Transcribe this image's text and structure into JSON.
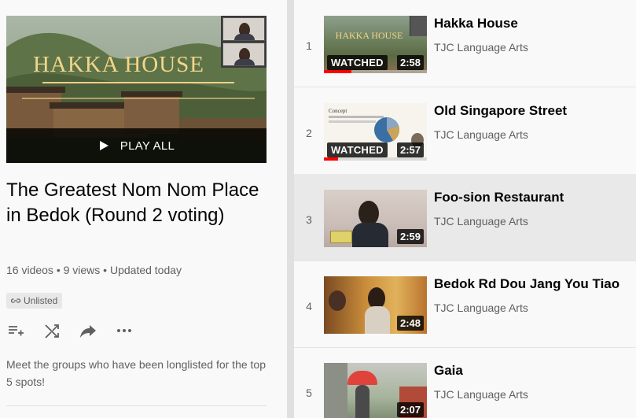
{
  "hero": {
    "title_text": "HAKKA HOUSE",
    "play_all_label": "PLAY ALL"
  },
  "playlist": {
    "title": "The Greatest Nom Nom Place in Bedok (Round 2 voting)",
    "stats": "16 videos • 9 views • Updated today",
    "visibility": "Unlisted",
    "description": "Meet the groups who have been longlisted for the top 5 spots!"
  },
  "icons": {
    "add_to_queue": "add-to-queue-icon",
    "shuffle": "shuffle-icon",
    "share": "share-icon",
    "more": "more-icon",
    "link": "link-icon",
    "play": "play-icon"
  },
  "colors": {
    "progress_red": "#ff0000",
    "text_secondary": "#606060",
    "text_primary": "#030303"
  },
  "videos": [
    {
      "index": "1",
      "title": "Hakka House",
      "channel": "TJC Language Arts",
      "duration": "2:58",
      "watched_label": "WATCHED",
      "watched_fraction": 0.27,
      "thumb_text": "HAKKA HOUSE"
    },
    {
      "index": "2",
      "title": "Old Singapore Street",
      "channel": "TJC Language Arts",
      "duration": "2:57",
      "watched_label": "WATCHED",
      "watched_fraction": 0.14,
      "thumb_text": "Concept"
    },
    {
      "index": "3",
      "title": "Foo-sion Restaurant",
      "channel": "TJC Language Arts",
      "duration": "2:59"
    },
    {
      "index": "4",
      "title": "Bedok Rd Dou Jang You Tiao",
      "channel": "TJC Language Arts",
      "duration": "2:48"
    },
    {
      "index": "5",
      "title": "Gaia",
      "channel": "TJC Language Arts",
      "duration": "2:07"
    }
  ]
}
